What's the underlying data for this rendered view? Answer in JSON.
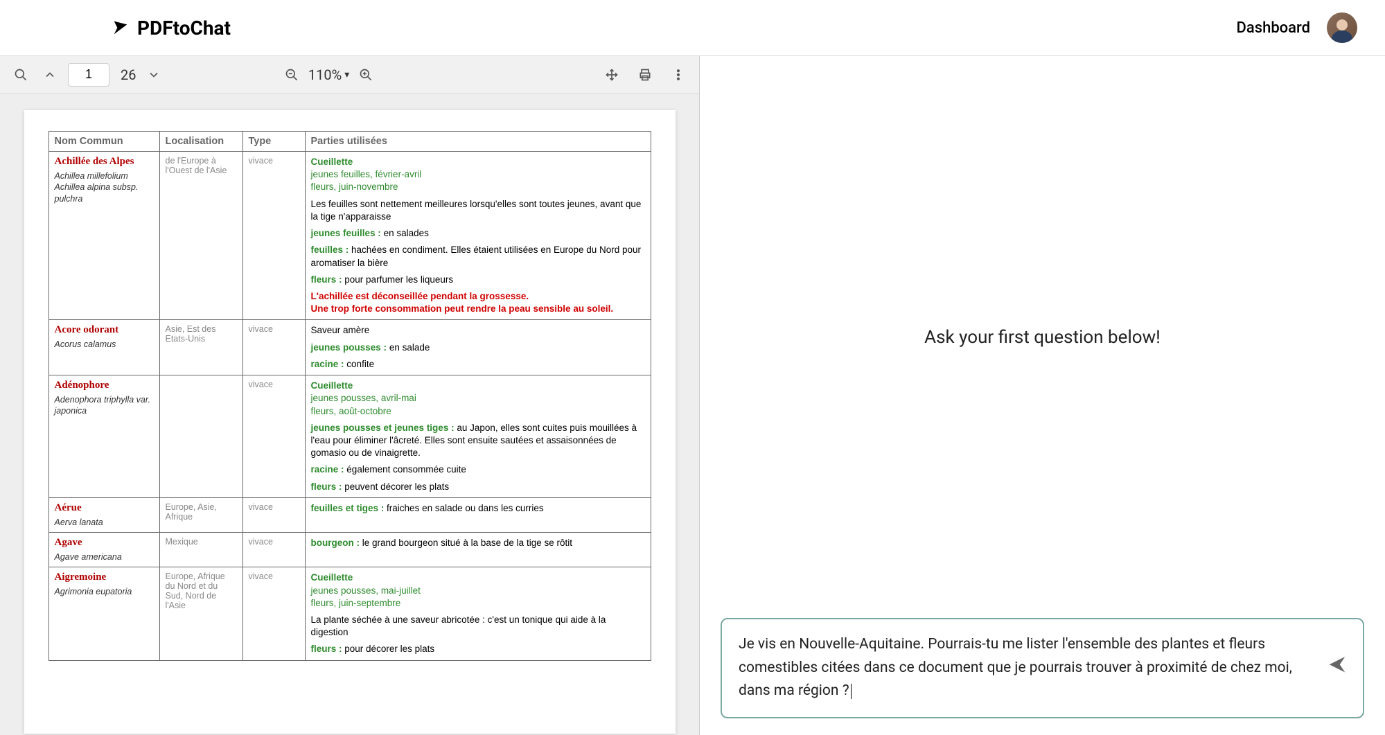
{
  "app": {
    "name": "PDFtoChat",
    "dashboard_label": "Dashboard"
  },
  "pdf_toolbar": {
    "page_current": "1",
    "page_total": "26",
    "zoom": "110%"
  },
  "doc": {
    "columns": {
      "nom": "Nom Commun",
      "loc": "Localisation",
      "type": "Type",
      "parts": "Parties utilisées"
    },
    "rows": [
      {
        "common": "Achillée des Alpes",
        "latin": "Achillea millefolium\nAchillea alpina subsp. pulchra",
        "loc": "de l'Europe à l'Ouest de l'Asie",
        "type": "vivace",
        "parts": [
          {
            "kind": "harvest",
            "title": "Cueillette",
            "lines": [
              "jeunes feuilles, février-avril",
              "fleurs, juin-novembre"
            ]
          },
          {
            "kind": "plain",
            "text": "Les feuilles sont nettement meilleures lorsqu'elles sont toutes jeunes, avant que la tige n'apparaisse"
          },
          {
            "kind": "kv",
            "key": "jeunes feuilles :",
            "val": "en salades"
          },
          {
            "kind": "kv",
            "key": "feuilles :",
            "val": "hachées en condiment. Elles étaient utilisées en Europe du Nord  pour aromatiser la bière"
          },
          {
            "kind": "kv",
            "key": "fleurs :",
            "val": "pour parfumer les liqueurs"
          },
          {
            "kind": "warn",
            "lines": [
              "L'achillée est déconseillée pendant la grossesse.",
              "Une trop forte consommation peut rendre la peau sensible au soleil."
            ]
          }
        ]
      },
      {
        "common": "Acore odorant",
        "latin": "Acorus calamus",
        "loc": "Asie, Est des Etats-Unis",
        "type": "vivace",
        "parts": [
          {
            "kind": "plain",
            "text": "Saveur amère"
          },
          {
            "kind": "kv",
            "key": "jeunes pousses :",
            "val": "en salade"
          },
          {
            "kind": "kv",
            "key": "racine :",
            "val": "confite"
          }
        ]
      },
      {
        "common": "Adénophore",
        "latin": "Adenophora triphylla var. japonica",
        "loc": "",
        "type": "vivace",
        "parts": [
          {
            "kind": "harvest",
            "title": "Cueillette",
            "lines": [
              "jeunes pousses, avril-mai",
              "fleurs, août-octobre"
            ]
          },
          {
            "kind": "kv",
            "key": "jeunes pousses et jeunes tiges :",
            "val": "au Japon, elles sont cuites puis mouillées à l'eau pour éliminer l'âcreté. Elles sont ensuite sautées et assaisonnées de gomasio ou de vinaigrette."
          },
          {
            "kind": "kv",
            "key": "racine :",
            "val": "également consommée cuite"
          },
          {
            "kind": "kv",
            "key": "fleurs :",
            "val": "peuvent décorer les plats"
          }
        ]
      },
      {
        "common": "Aérue",
        "latin": "Aerva lanata",
        "loc": "Europe, Asie, Afrique",
        "type": "vivace",
        "parts": [
          {
            "kind": "kv",
            "key": "feuilles et tiges :",
            "val": "fraiches en salade ou dans les curries"
          }
        ]
      },
      {
        "common": "Agave",
        "latin": "Agave americana",
        "loc": "Mexique",
        "type": "vivace",
        "parts": [
          {
            "kind": "kv",
            "key": "bourgeon :",
            "val": "le grand bourgeon situé à la base de la tige se rôtit"
          }
        ]
      },
      {
        "common": "Aigremoine",
        "latin": "Agrimonia eupatoria",
        "loc": "Europe, Afrique du Nord et du Sud, Nord de l'Asie",
        "type": "vivace",
        "parts": [
          {
            "kind": "harvest",
            "title": "Cueillette",
            "lines": [
              "jeunes pousses, mai-juillet",
              "fleurs, juin-septembre"
            ]
          },
          {
            "kind": "plain",
            "text": "La plante séchée à une saveur abricotée : c'est un tonique qui aide à la digestion"
          },
          {
            "kind": "kv",
            "key": "fleurs :",
            "val": "pour décorer les plats"
          }
        ]
      }
    ]
  },
  "chat": {
    "empty_prompt": "Ask your first question below!",
    "input_text": "Je vis en Nouvelle-Aquitaine. Pourrais-tu me lister l'ensemble des plantes  et fleurs comestibles citées dans ce document que je pourrais trouver à proximité de chez moi, dans ma région ?"
  },
  "icons": {
    "search": "search-icon",
    "up": "prev-page-icon",
    "down": "next-page-icon",
    "zoom_out": "zoom-out-icon",
    "zoom_in": "zoom-in-icon",
    "pan": "pan-icon",
    "print": "print-icon",
    "more": "more-icon",
    "send": "send-icon"
  }
}
